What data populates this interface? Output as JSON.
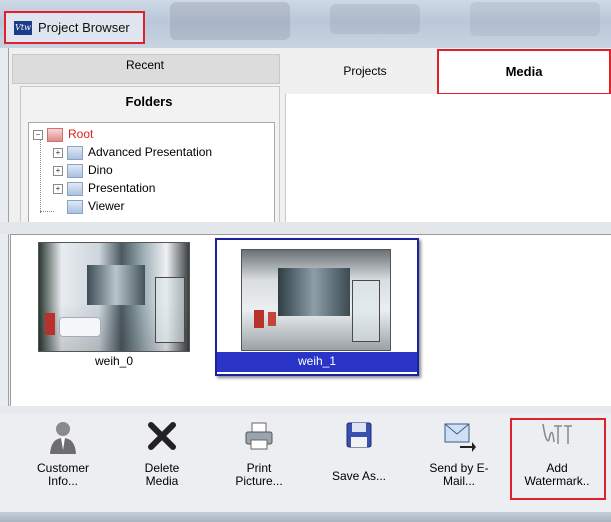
{
  "window": {
    "title": "Project Browser",
    "app_icon_text": "Vtw"
  },
  "tabs": {
    "recent": "Recent",
    "projects": "Projects",
    "media": "Media"
  },
  "folders": {
    "header": "Folders",
    "tree": [
      {
        "label": "Root",
        "expander": "−",
        "color": "#e02020"
      },
      {
        "label": "Advanced Presentation",
        "expander": "+"
      },
      {
        "label": "Dino",
        "expander": "+"
      },
      {
        "label": "Presentation",
        "expander": "+"
      },
      {
        "label": "Viewer",
        "expander": ""
      }
    ]
  },
  "media": {
    "items": [
      {
        "label": "weih_0",
        "selected": false
      },
      {
        "label": "weih_1",
        "selected": true
      }
    ]
  },
  "toolbar": {
    "customer_info": "Customer\nInfo...",
    "delete_media": "Delete\nMedia",
    "print_picture": "Print\nPicture...",
    "save_as": "Save As...",
    "send_email": "Send by E-\nMail...",
    "add_watermark": "Add\nWatermark..",
    "icons": {
      "customer_info": "person-icon",
      "delete_media": "delete-x-icon",
      "print_picture": "printer-icon",
      "save_as": "floppy-disk-icon",
      "send_email": "envelope-icon",
      "add_watermark": "watermark-icon"
    }
  },
  "colors": {
    "highlight": "#e0202a",
    "selection": "#2a35c8",
    "root_text": "#e02020"
  }
}
